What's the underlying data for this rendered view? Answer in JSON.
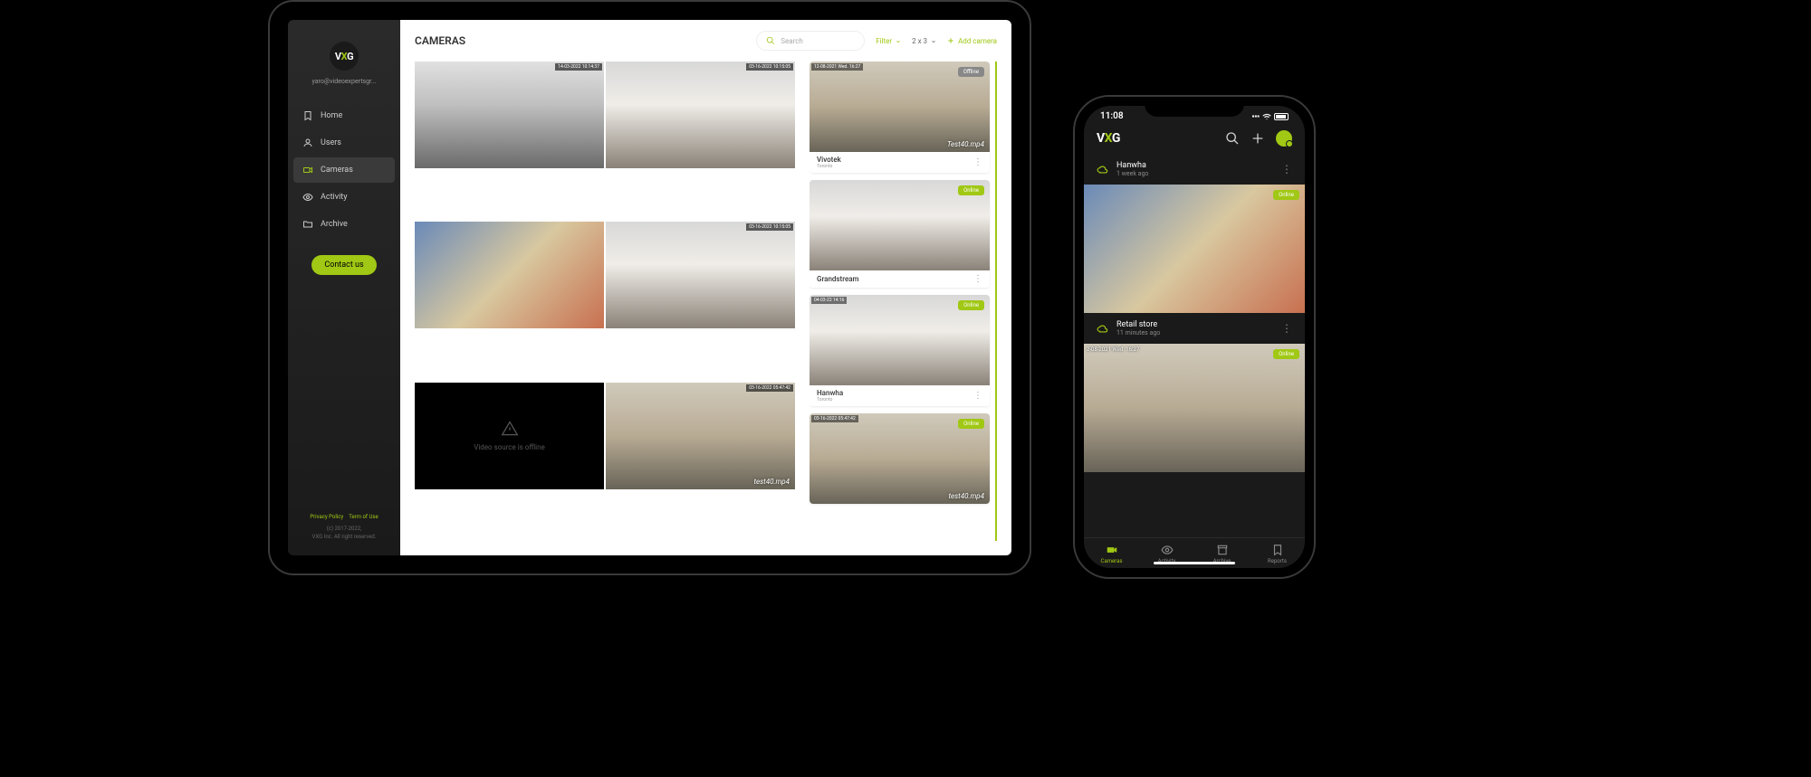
{
  "tablet": {
    "logo_prefix": "V",
    "logo_accent": "X",
    "logo_suffix": "G",
    "user_email": "yaro@videoexpertsgr...",
    "nav": [
      {
        "label": "Home",
        "icon": "home"
      },
      {
        "label": "Users",
        "icon": "users"
      },
      {
        "label": "Cameras",
        "icon": "camera",
        "active": true
      },
      {
        "label": "Activity",
        "icon": "eye"
      },
      {
        "label": "Archive",
        "icon": "folder"
      }
    ],
    "contact_label": "Contact us",
    "footer": {
      "privacy": "Privacy Policy",
      "terms": "Term of Use",
      "copyright1": "(c) 2017-2022,",
      "copyright2": "VXG Inc. All right reserved."
    },
    "page_title": "CAMERAS",
    "search_placeholder": "Search",
    "filter_label": "Filter",
    "grid_label": "2 x 3",
    "add_label": "Add camera",
    "grid_tiles": [
      {
        "timestamp": "14-03-2022 10:14:37",
        "scene": "street",
        "label": ""
      },
      {
        "timestamp": "03-16-2022 10:15:05",
        "scene": "snow",
        "label": ""
      },
      {
        "timestamp": "",
        "scene": "store",
        "label": ""
      },
      {
        "timestamp": "03-16-2022 10:15:05",
        "scene": "snow",
        "label": ""
      },
      {
        "timestamp": "",
        "scene": "offline",
        "label": "Video source is offline"
      },
      {
        "timestamp": "03-16-2022 05:47:42",
        "scene": "checkout",
        "label": "test40.mp4"
      }
    ],
    "list_cards": [
      {
        "name": "Vivotek",
        "location": "Toronto",
        "status": "Offline",
        "timestamp": "12-08-2021 Wed. 16:27",
        "scene": "checkout",
        "label": "Test40.mp4"
      },
      {
        "name": "Grandstream",
        "location": "",
        "status": "Online",
        "timestamp": "",
        "scene": "snow",
        "label": ""
      },
      {
        "name": "Hanwha",
        "location": "Toronto",
        "status": "Online",
        "timestamp": "04-03-22 14:16",
        "scene": "snow",
        "label": ""
      },
      {
        "name": "",
        "location": "",
        "status": "Online",
        "timestamp": "03-16-2022 05:47:42",
        "scene": "checkout",
        "label": "test40.mp4"
      }
    ]
  },
  "phone": {
    "time": "11:08",
    "logo_prefix": "V",
    "logo_accent": "X",
    "logo_suffix": "G",
    "cameras": [
      {
        "name": "Hanwha",
        "time": "1 week ago",
        "status": "Online",
        "scene": "store",
        "timestamp": ""
      },
      {
        "name": "Retail store",
        "time": "11 minutes ago",
        "status": "Online",
        "scene": "checkout",
        "timestamp": "2-08-2021 Wed.  16:27"
      }
    ],
    "nav": [
      {
        "label": "Cameras",
        "icon": "camera",
        "active": true
      },
      {
        "label": "Activity",
        "icon": "eye"
      },
      {
        "label": "Archive",
        "icon": "archive"
      },
      {
        "label": "Reports",
        "icon": "report"
      }
    ]
  }
}
